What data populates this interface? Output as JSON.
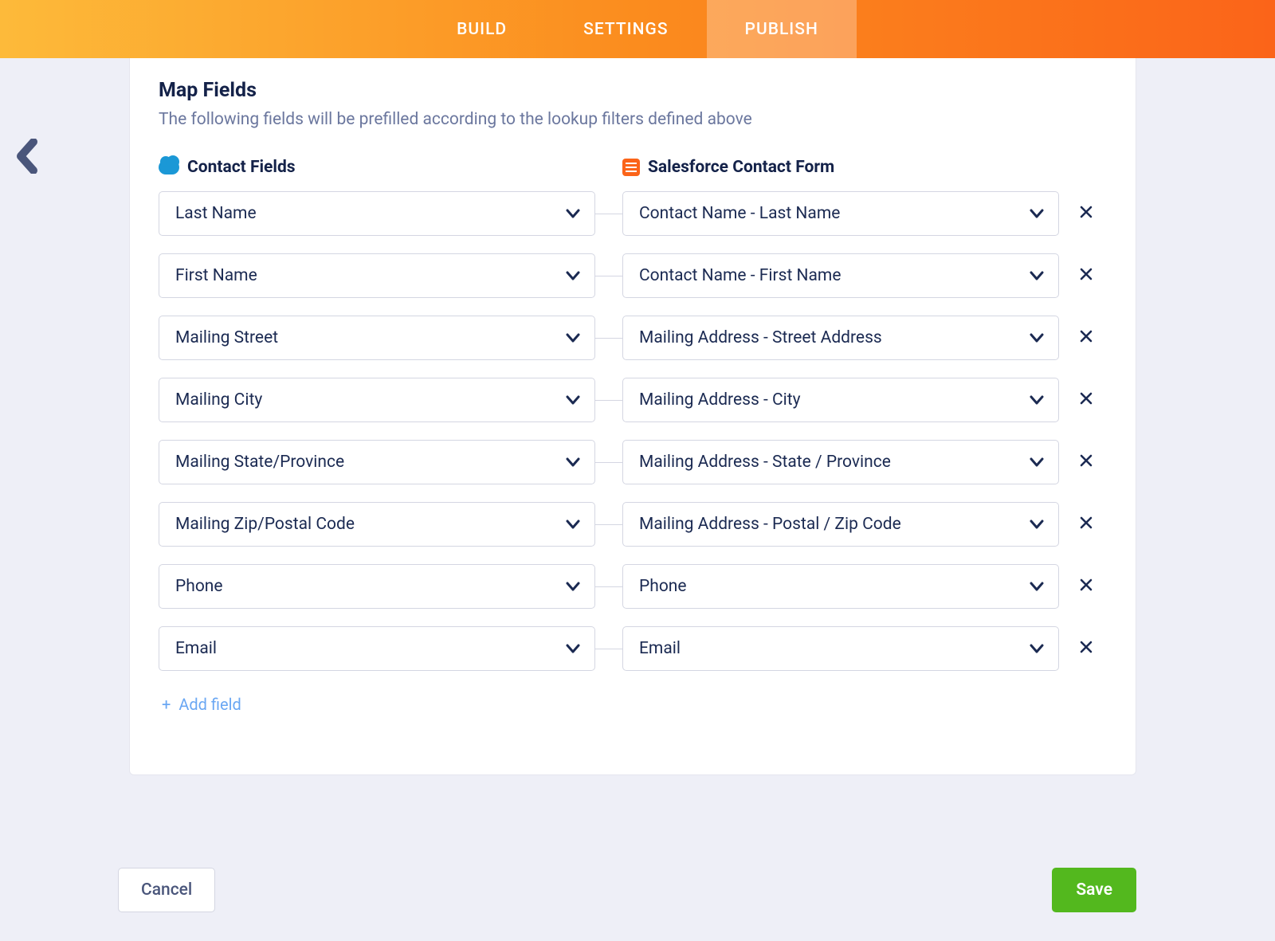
{
  "tabs": {
    "build": "BUILD",
    "settings": "SETTINGS",
    "publish": "PUBLISH"
  },
  "section": {
    "title": "Map Fields",
    "description": "The following fields will be prefilled according to the lookup filters defined above"
  },
  "columns": {
    "left": "Contact Fields",
    "right": "Salesforce Contact Form"
  },
  "rows": [
    {
      "left": "Last Name",
      "right": "Contact Name - Last Name"
    },
    {
      "left": "First Name",
      "right": "Contact Name - First Name"
    },
    {
      "left": "Mailing Street",
      "right": "Mailing Address - Street Address"
    },
    {
      "left": "Mailing City",
      "right": "Mailing Address - City"
    },
    {
      "left": "Mailing State/Province",
      "right": "Mailing Address - State / Province"
    },
    {
      "left": "Mailing Zip/Postal Code",
      "right": "Mailing Address - Postal / Zip Code"
    },
    {
      "left": "Phone",
      "right": "Phone"
    },
    {
      "left": "Email",
      "right": "Email"
    }
  ],
  "add_field_label": "Add field",
  "buttons": {
    "cancel": "Cancel",
    "save": "Save"
  }
}
